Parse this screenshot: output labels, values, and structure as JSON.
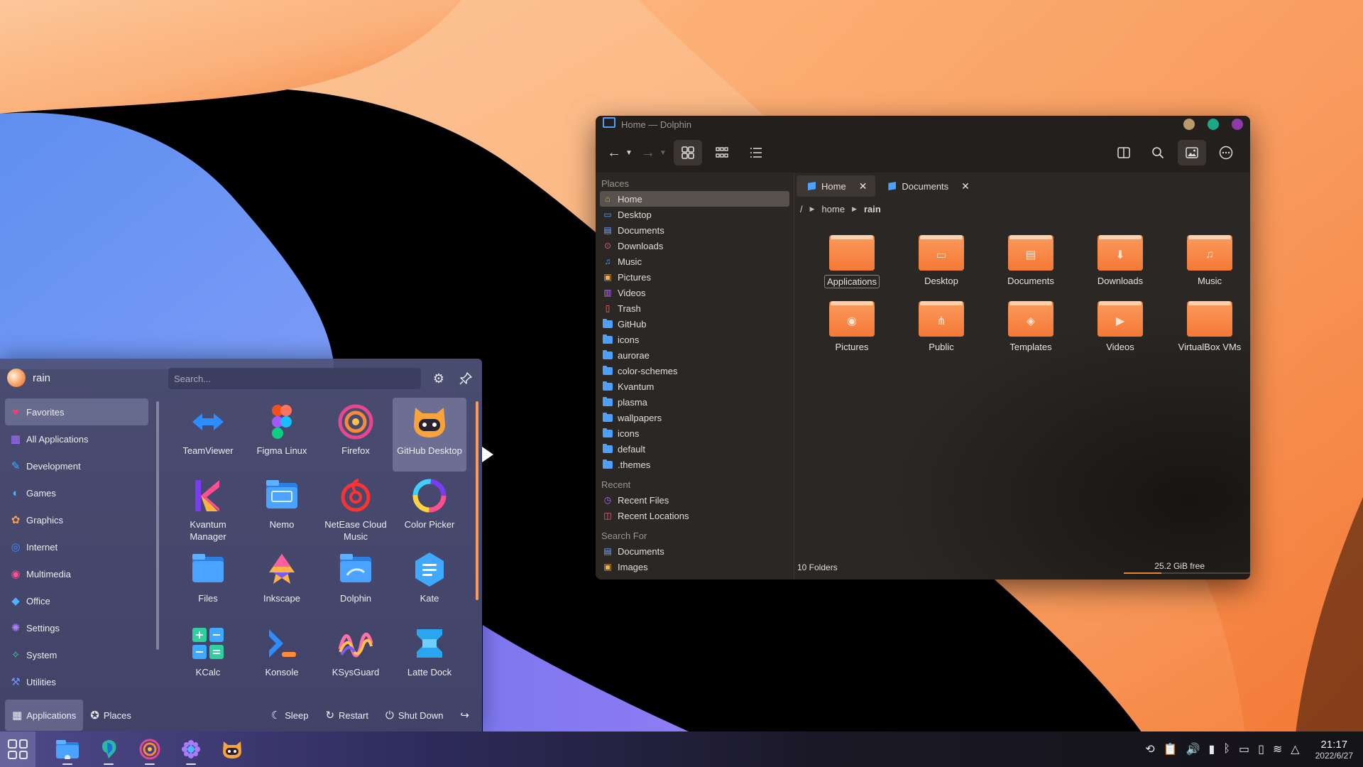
{
  "dolphin": {
    "title": "Home — Dolphin",
    "places_header": "Places",
    "places": [
      {
        "label": "Home",
        "icon": "home-icon",
        "selected": true
      },
      {
        "label": "Desktop",
        "icon": "desktop-icon"
      },
      {
        "label": "Documents",
        "icon": "documents-icon"
      },
      {
        "label": "Downloads",
        "icon": "downloads-icon"
      },
      {
        "label": "Music",
        "icon": "music-icon"
      },
      {
        "label": "Pictures",
        "icon": "pictures-icon"
      },
      {
        "label": "Videos",
        "icon": "videos-icon"
      },
      {
        "label": "Trash",
        "icon": "trash-icon"
      },
      {
        "label": "GitHub",
        "icon": "folder-icon"
      },
      {
        "label": "icons",
        "icon": "folder-icon"
      },
      {
        "label": "aurorae",
        "icon": "folder-icon"
      },
      {
        "label": "color-schemes",
        "icon": "folder-icon"
      },
      {
        "label": "Kvantum",
        "icon": "folder-icon"
      },
      {
        "label": "plasma",
        "icon": "folder-icon"
      },
      {
        "label": "wallpapers",
        "icon": "folder-icon"
      },
      {
        "label": "icons",
        "icon": "folder-icon"
      },
      {
        "label": "default",
        "icon": "folder-icon"
      },
      {
        "label": ".themes",
        "icon": "folder-icon"
      }
    ],
    "recent_header": "Recent",
    "recent": [
      {
        "label": "Recent Files",
        "icon": "recent-files-icon"
      },
      {
        "label": "Recent Locations",
        "icon": "recent-locations-icon"
      }
    ],
    "search_header": "Search For",
    "search_for": [
      {
        "label": "Documents",
        "icon": "documents-icon"
      },
      {
        "label": "Images",
        "icon": "images-icon"
      }
    ],
    "tabs": [
      {
        "label": "Home",
        "close": "✕",
        "active": true
      },
      {
        "label": "Documents",
        "close": "✕",
        "active": false
      }
    ],
    "breadcrumb": {
      "root": "/",
      "parts": [
        "home",
        "rain"
      ]
    },
    "folders": [
      {
        "label": "Applications",
        "emblem": "",
        "selected": true
      },
      {
        "label": "Desktop",
        "emblem": "▭"
      },
      {
        "label": "Documents",
        "emblem": "▤"
      },
      {
        "label": "Downloads",
        "emblem": "⬇"
      },
      {
        "label": "Music",
        "emblem": "♫"
      },
      {
        "label": "Pictures",
        "emblem": "◉"
      },
      {
        "label": "Public",
        "emblem": "⋔"
      },
      {
        "label": "Templates",
        "emblem": "◈"
      },
      {
        "label": "Videos",
        "emblem": "▶"
      },
      {
        "label": "VirtualBox VMs",
        "emblem": ""
      }
    ],
    "status_count": "10 Folders",
    "free_space": "25.2 GiB free",
    "used_fraction": 0.3,
    "colors": {
      "accent": "#4ea0ff",
      "folder": "#f47936",
      "dot1": "#b89a6c",
      "dot2": "#1aa984",
      "dot3": "#8e3aa8"
    }
  },
  "menu": {
    "user": "rain",
    "search_placeholder": "Search...",
    "categories": [
      {
        "label": "Favorites",
        "icon": "heart-icon",
        "selected": true
      },
      {
        "label": "All Applications",
        "icon": "grid-icon"
      },
      {
        "label": "Development",
        "icon": "development-icon"
      },
      {
        "label": "Games",
        "icon": "games-icon"
      },
      {
        "label": "Graphics",
        "icon": "graphics-icon"
      },
      {
        "label": "Internet",
        "icon": "internet-icon"
      },
      {
        "label": "Multimedia",
        "icon": "multimedia-icon"
      },
      {
        "label": "Office",
        "icon": "office-icon"
      },
      {
        "label": "Settings",
        "icon": "settings-icon"
      },
      {
        "label": "System",
        "icon": "system-icon"
      },
      {
        "label": "Utilities",
        "icon": "utilities-icon"
      }
    ],
    "apps": [
      {
        "label": "TeamViewer",
        "icon": "teamviewer-icon"
      },
      {
        "label": "Figma Linux",
        "icon": "figma-icon"
      },
      {
        "label": "Firefox",
        "icon": "firefox-icon"
      },
      {
        "label": "GitHub Desktop",
        "icon": "github-icon",
        "selected": true
      },
      {
        "label": "Kvantum Manager",
        "icon": "kvantum-icon"
      },
      {
        "label": "Nemo",
        "icon": "nemo-icon"
      },
      {
        "label": "NetEase Cloud Music",
        "icon": "netease-icon"
      },
      {
        "label": "Color Picker",
        "icon": "color-picker-icon"
      },
      {
        "label": "Files",
        "icon": "files-icon"
      },
      {
        "label": "Inkscape",
        "icon": "inkscape-icon"
      },
      {
        "label": "Dolphin",
        "icon": "dolphin-icon"
      },
      {
        "label": "Kate",
        "icon": "kate-icon"
      },
      {
        "label": "KCalc",
        "icon": "kcalc-icon"
      },
      {
        "label": "Konsole",
        "icon": "konsole-icon"
      },
      {
        "label": "KSysGuard",
        "icon": "ksysguard-icon"
      },
      {
        "label": "Latte Dock",
        "icon": "latte-icon"
      }
    ],
    "footer": {
      "applications": "Applications",
      "places": "Places",
      "sleep": "Sleep",
      "restart": "Restart",
      "shutdown": "Shut Down"
    }
  },
  "taskbar": {
    "time": "21:17",
    "date": "2022/6/27",
    "tasks": [
      "dolphin-icon",
      "kde-connect-icon",
      "firefox-icon",
      "settings-icon",
      "github-icon"
    ]
  }
}
